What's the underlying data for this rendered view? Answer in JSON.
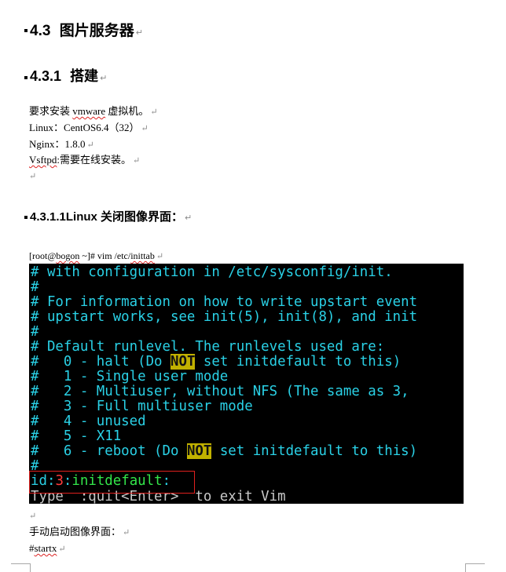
{
  "heading_1": {
    "number": "4.3",
    "title": "图片服务器"
  },
  "heading_2": {
    "number": "4.3.1",
    "title": "搭建"
  },
  "requirements": {
    "line1_pre": "要求安装 ",
    "line1_vm": "vmware",
    "line1_post": " 虚拟机。",
    "line2": "Linux：CentOS6.4（32）",
    "line3": "Nginx：1.8.0",
    "line4_pre": "Vsftpd",
    "line4_post": ":需要在线安装。"
  },
  "heading_3": {
    "text": "4.3.1.1Linux 关闭图像界面："
  },
  "command": {
    "pre": "[root@",
    "host": "bogon",
    "mid": " ~]# vim /etc/",
    "file": "inittab"
  },
  "terminal": {
    "lines": [
      "# with configuration in /etc/sysconfig/init.",
      "#",
      "# For information on how to write upstart event",
      "# upstart works, see init(5), init(8), and init",
      "#",
      "# Default runlevel. The runlevels used are:",
      "#   0 - halt (Do ",
      "#   1 - Single user mode",
      "#   2 - Multiuser, without NFS (The same as 3,",
      "#   3 - Full multiuser mode",
      "#   4 - unused",
      "#   5 - X11",
      "#   6 - reboot (Do ",
      "#"
    ],
    "halt_tail": " set initdefault to this)",
    "reboot_tail": " set initdefault to this)",
    "not_word": "NOT",
    "initdefault": {
      "id": "id",
      "sep1": ":",
      "level": "3",
      "sep2": ":",
      "name": "initdefault",
      "sep3": ":"
    },
    "status_line": "Type  :quit<Enter>  to exit Vim"
  },
  "footer": {
    "manual_start": "手动启动图像界面：",
    "startx_hash": "#",
    "startx_cmd": "startx"
  },
  "paragraph_mark": "↵",
  "colors": {
    "terminal_bg": "#000000",
    "terminal_text": "#2ad1e6",
    "highlight_bg": "#c1b100",
    "runlevel_red": "#ff3b3b",
    "initdefault_green": "#33e64a",
    "annotation_box": "#e0201e",
    "spellcheck_underline": "#d22222"
  }
}
